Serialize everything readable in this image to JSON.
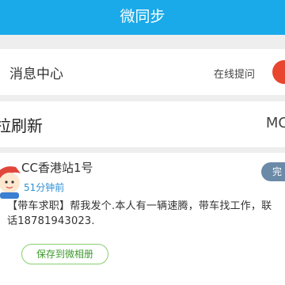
{
  "header": {
    "title": "微同步"
  },
  "message_center": {
    "title": "消息中心",
    "ask_online": "在线提问"
  },
  "refresh_bar": {
    "label": "拉刷新",
    "more": "MC"
  },
  "post": {
    "user_name": "CC香港站1号",
    "time": "51分钟前",
    "status_button": "完",
    "text_line1": "【带车求职】帮我发个.本人有一辆速腾，带车找工作，联",
    "text_line2": "话18781943023.",
    "save_button": "保存到微相册"
  },
  "colors": {
    "header": "#1aaae9",
    "accent_blue": "#2f8fd6",
    "save_green": "#3d9a2b",
    "alert_red": "#e8462f"
  }
}
